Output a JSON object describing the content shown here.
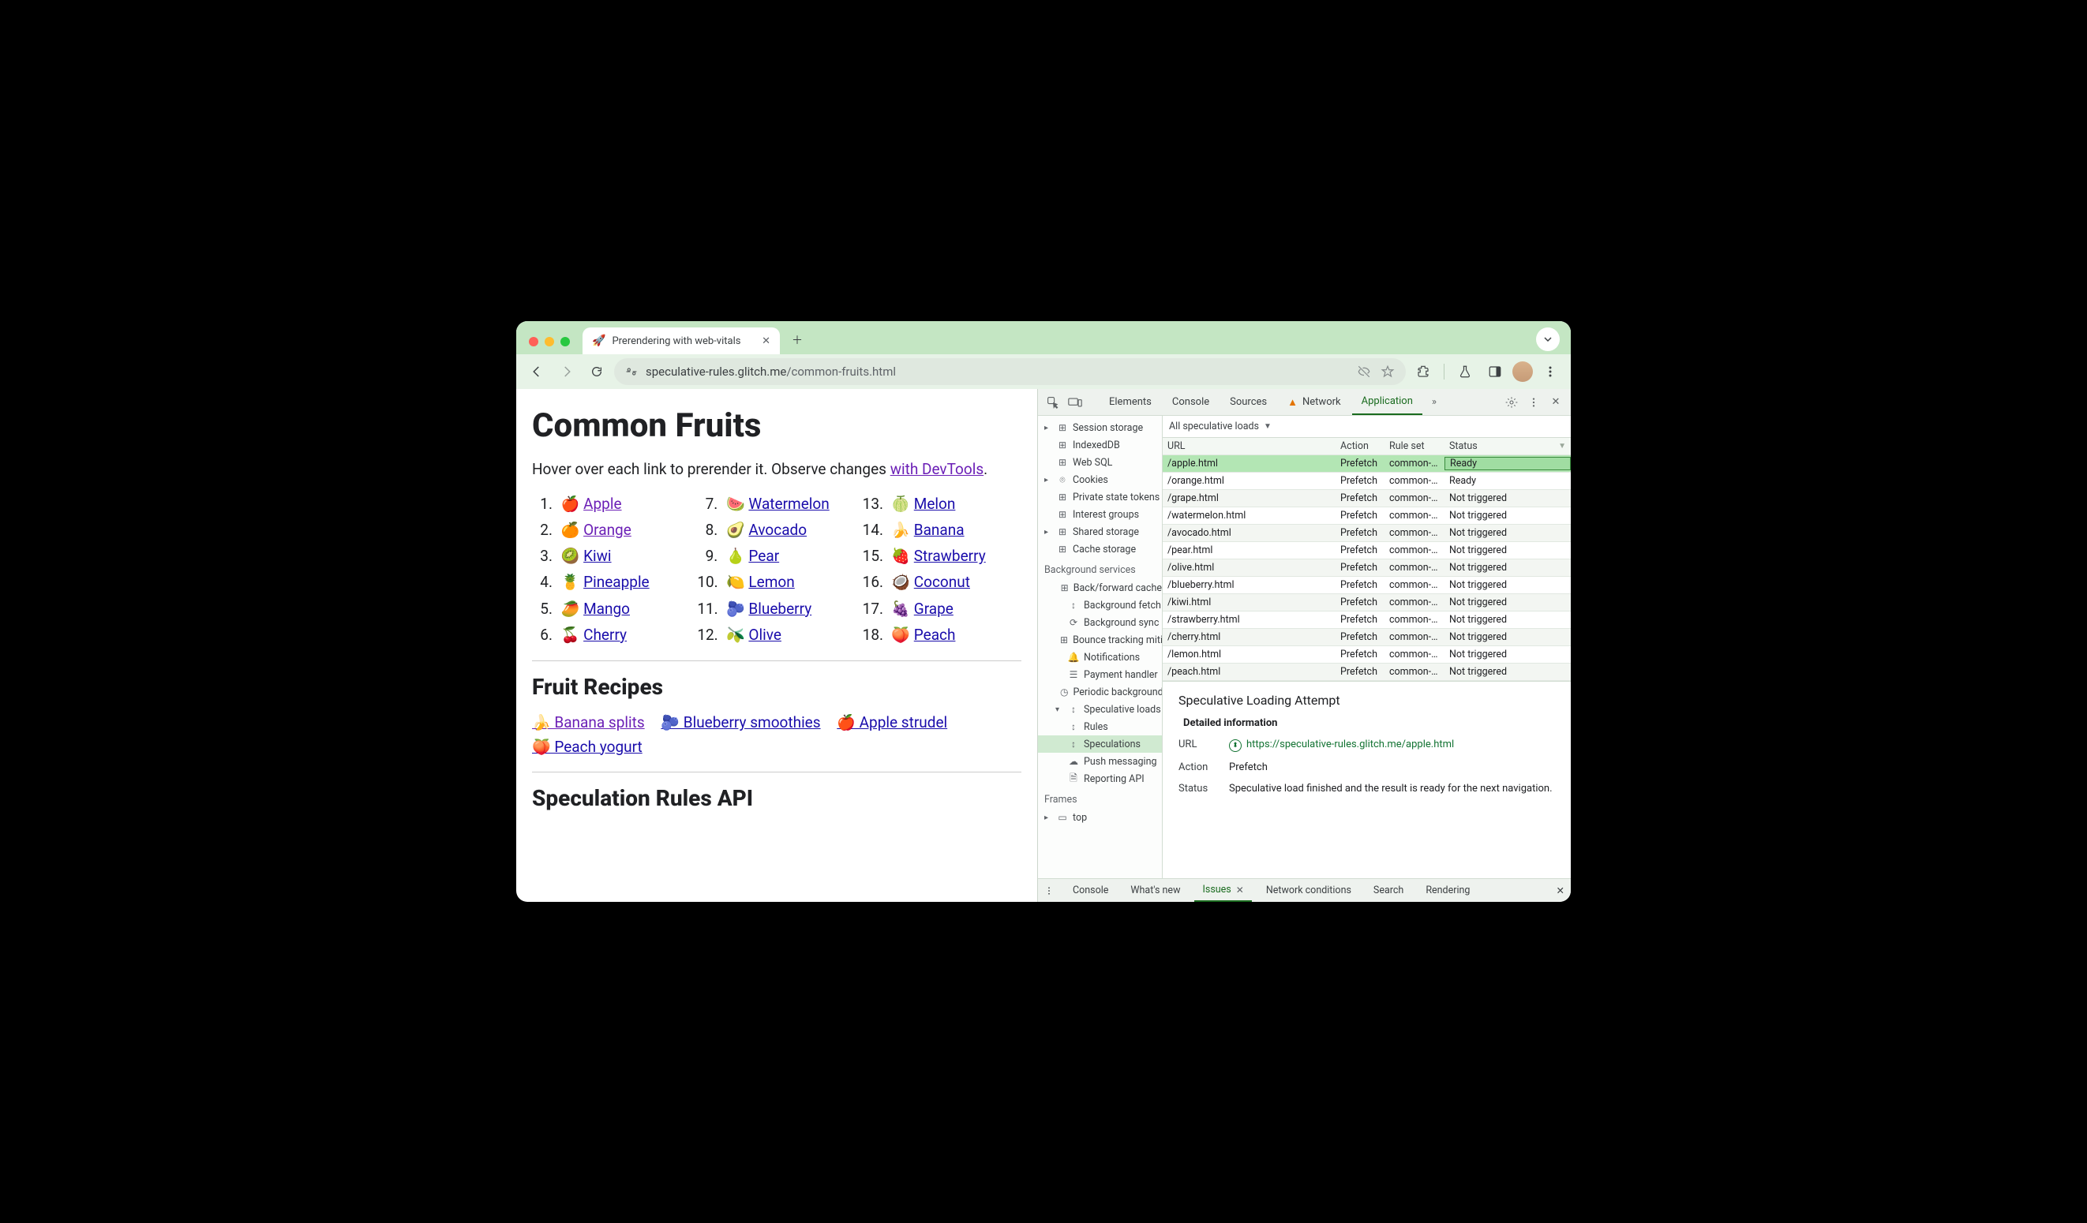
{
  "tab": {
    "title": "Prerendering with web-vitals"
  },
  "url": {
    "host": "speculative-rules.glitch.me",
    "path": "/common-fruits.html"
  },
  "page": {
    "h1": "Common Fruits",
    "intro_prefix": "Hover over each link to prerender it. Observe changes ",
    "intro_link": "with DevTools",
    "intro_suffix": ".",
    "fruits": [
      {
        "n": "1",
        "emoji": "🍎",
        "label": "Apple",
        "visited": true
      },
      {
        "n": "2",
        "emoji": "🍊",
        "label": "Orange",
        "visited": true
      },
      {
        "n": "3",
        "emoji": "🥝",
        "label": "Kiwi",
        "visited": false
      },
      {
        "n": "4",
        "emoji": "🍍",
        "label": "Pineapple",
        "visited": false
      },
      {
        "n": "5",
        "emoji": "🥭",
        "label": "Mango",
        "visited": false
      },
      {
        "n": "6",
        "emoji": "🍒",
        "label": "Cherry",
        "visited": false
      },
      {
        "n": "7",
        "emoji": "🍉",
        "label": "Watermelon",
        "visited": false
      },
      {
        "n": "8",
        "emoji": "🥑",
        "label": "Avocado",
        "visited": false
      },
      {
        "n": "9",
        "emoji": "🍐",
        "label": "Pear",
        "visited": false
      },
      {
        "n": "10",
        "emoji": "🍋",
        "label": "Lemon",
        "visited": false
      },
      {
        "n": "11",
        "emoji": "🫐",
        "label": "Blueberry",
        "visited": false
      },
      {
        "n": "12",
        "emoji": "🫒",
        "label": "Olive",
        "visited": false
      },
      {
        "n": "13",
        "emoji": "🍈",
        "label": "Melon",
        "visited": false
      },
      {
        "n": "14",
        "emoji": "🍌",
        "label": "Banana",
        "visited": false
      },
      {
        "n": "15",
        "emoji": "🍓",
        "label": "Strawberry",
        "visited": false
      },
      {
        "n": "16",
        "emoji": "🥥",
        "label": "Coconut",
        "visited": false
      },
      {
        "n": "17",
        "emoji": "🍇",
        "label": "Grape",
        "visited": false
      },
      {
        "n": "18",
        "emoji": "🍑",
        "label": "Peach",
        "visited": false
      }
    ],
    "h2_recipes": "Fruit Recipes",
    "recipes": [
      {
        "emoji": "🍌",
        "label": "Banana splits",
        "visited": true
      },
      {
        "emoji": "🫐",
        "label": "Blueberry smoothies",
        "visited": false
      },
      {
        "emoji": "🍎",
        "label": "Apple strudel",
        "visited": false
      },
      {
        "emoji": "🍑",
        "label": "Peach yogurt",
        "visited": false
      }
    ],
    "h2_api": "Speculation Rules API"
  },
  "devtools": {
    "tabs": {
      "elements": "Elements",
      "console": "Console",
      "sources": "Sources",
      "network": "Network",
      "application": "Application"
    },
    "sidebar": {
      "storage": [
        {
          "icon": "⊞",
          "label": "Session storage",
          "tree": "▸"
        },
        {
          "icon": "⊞",
          "label": "IndexedDB",
          "tree": ""
        },
        {
          "icon": "⊞",
          "label": "Web SQL",
          "tree": ""
        },
        {
          "icon": "⌾",
          "label": "Cookies",
          "tree": "▸"
        },
        {
          "icon": "⊞",
          "label": "Private state tokens",
          "tree": ""
        },
        {
          "icon": "⊞",
          "label": "Interest groups",
          "tree": ""
        },
        {
          "icon": "⊞",
          "label": "Shared storage",
          "tree": "▸"
        },
        {
          "icon": "⊞",
          "label": "Cache storage",
          "tree": ""
        }
      ],
      "bg_header": "Background services",
      "bg": [
        {
          "icon": "⊞",
          "label": "Back/forward cache"
        },
        {
          "icon": "↕",
          "label": "Background fetch"
        },
        {
          "icon": "⟳",
          "label": "Background sync"
        },
        {
          "icon": "⊞",
          "label": "Bounce tracking mitigation"
        },
        {
          "icon": "🔔",
          "label": "Notifications"
        },
        {
          "icon": "☰",
          "label": "Payment handler"
        },
        {
          "icon": "◷",
          "label": "Periodic background"
        },
        {
          "icon": "↕",
          "label": "Speculative loads",
          "tree": "▾"
        }
      ],
      "spec_children": [
        {
          "icon": "↕",
          "label": "Rules"
        },
        {
          "icon": "↕",
          "label": "Speculations",
          "selected": true
        }
      ],
      "tail": [
        {
          "icon": "☁",
          "label": "Push messaging"
        },
        {
          "icon": "🗎",
          "label": "Reporting API"
        }
      ],
      "frames_header": "Frames",
      "frames": [
        {
          "icon": "▭",
          "label": "top",
          "tree": "▸"
        }
      ]
    },
    "filter": "All speculative loads",
    "columns": {
      "url": "URL",
      "action": "Action",
      "rule": "Rule set",
      "status": "Status"
    },
    "rows": [
      {
        "url": "/apple.html",
        "action": "Prefetch",
        "rule": "common-…",
        "status": "Ready",
        "selected": true
      },
      {
        "url": "/orange.html",
        "action": "Prefetch",
        "rule": "common-…",
        "status": "Ready"
      },
      {
        "url": "/grape.html",
        "action": "Prefetch",
        "rule": "common-…",
        "status": "Not triggered"
      },
      {
        "url": "/watermelon.html",
        "action": "Prefetch",
        "rule": "common-…",
        "status": "Not triggered"
      },
      {
        "url": "/avocado.html",
        "action": "Prefetch",
        "rule": "common-…",
        "status": "Not triggered"
      },
      {
        "url": "/pear.html",
        "action": "Prefetch",
        "rule": "common-…",
        "status": "Not triggered"
      },
      {
        "url": "/olive.html",
        "action": "Prefetch",
        "rule": "common-…",
        "status": "Not triggered"
      },
      {
        "url": "/blueberry.html",
        "action": "Prefetch",
        "rule": "common-…",
        "status": "Not triggered"
      },
      {
        "url": "/kiwi.html",
        "action": "Prefetch",
        "rule": "common-…",
        "status": "Not triggered"
      },
      {
        "url": "/strawberry.html",
        "action": "Prefetch",
        "rule": "common-…",
        "status": "Not triggered"
      },
      {
        "url": "/cherry.html",
        "action": "Prefetch",
        "rule": "common-…",
        "status": "Not triggered"
      },
      {
        "url": "/lemon.html",
        "action": "Prefetch",
        "rule": "common-…",
        "status": "Not triggered"
      },
      {
        "url": "/peach.html",
        "action": "Prefetch",
        "rule": "common-…",
        "status": "Not triggered"
      }
    ],
    "detail": {
      "title": "Speculative Loading Attempt",
      "sub": "Detailed information",
      "url_label": "URL",
      "url_value": "https://speculative-rules.glitch.me/apple.html",
      "action_label": "Action",
      "action_value": "Prefetch",
      "status_label": "Status",
      "status_value": "Speculative load finished and the result is ready for the next navigation."
    },
    "drawer": {
      "console": "Console",
      "whatsnew": "What's new",
      "issues": "Issues",
      "netcond": "Network conditions",
      "search": "Search",
      "rendering": "Rendering"
    }
  }
}
